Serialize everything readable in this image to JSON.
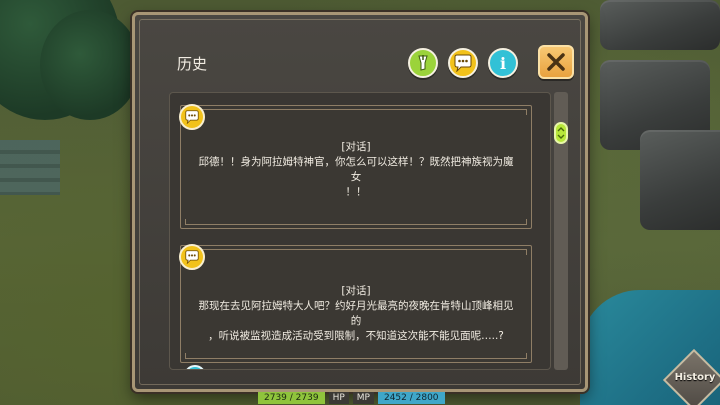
{
  "panel": {
    "title": "历史",
    "buttons": {
      "filter_icon": "filter-icon",
      "talk_icon": "speech-bubble-icon",
      "info_label": "i",
      "close_icon": "close-icon"
    }
  },
  "entries": [
    {
      "icon": "speech-bubble-icon",
      "tag": "[对话]",
      "line1": "邱德！！身为阿拉姆特神官，你怎么可以这样！？既然把神族视为魔女",
      "line2": "！！"
    },
    {
      "icon": "speech-bubble-icon",
      "tag": "[对话]",
      "line1": "那现在去见阿拉姆特大人吧？约好月光最亮的夜晚在肯特山顶峰相见的",
      "line2": "，听说被监视造成活动受到限制，不知道这次能不能见面呢…..?"
    }
  ],
  "hud": {
    "hp_value": "2739 / 2739",
    "hp_label": "HP",
    "mp_label": "MP",
    "mp_value": "2452 / 2800"
  },
  "history_button": {
    "label": "History"
  },
  "colors": {
    "accent_green": "#9bd33a",
    "accent_yellow": "#f2c21b",
    "accent_cyan": "#32c1d6",
    "close_orange": "#e9a23f"
  }
}
